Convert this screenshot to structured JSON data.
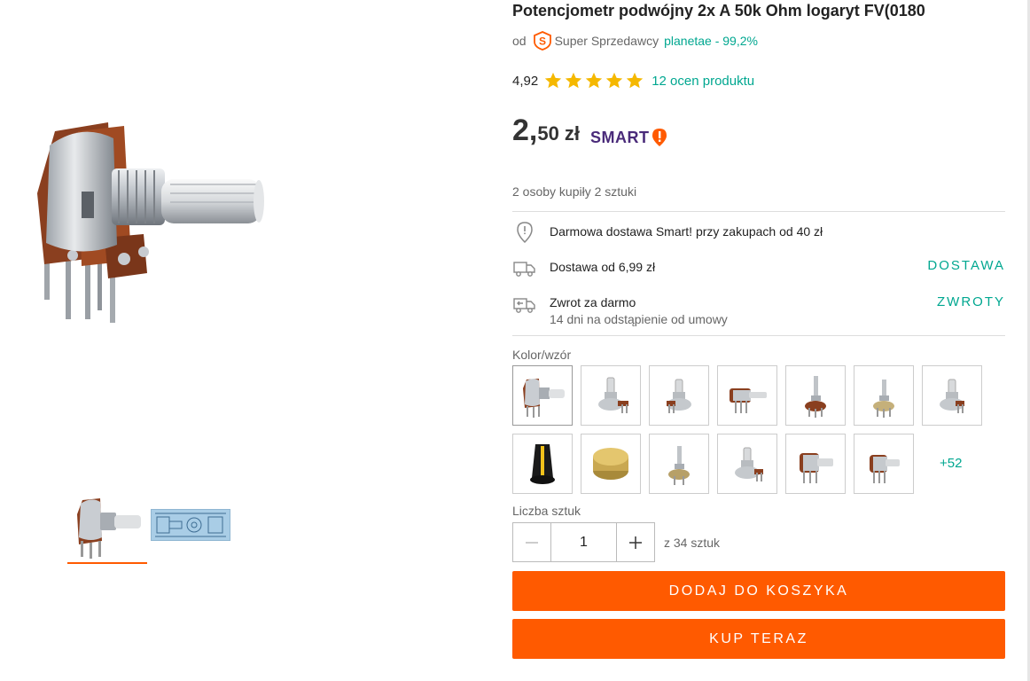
{
  "product": {
    "title": "Potencjometr podwójny 2x A 50k Ohm logaryt FV(0180",
    "seller_prefix": "od",
    "seller_badge": "Super Sprzedawcy",
    "seller_name": "planetae - 99,2%",
    "rating_score": "4,92",
    "rating_stars": 5,
    "rating_count": "12 ocen produktu",
    "price_main": "2,",
    "price_cents": "50",
    "price_currency": "zł",
    "smart_label": "SMART",
    "bought_text": "2 osoby kupiły 2 sztuki"
  },
  "delivery": {
    "free_text": "Darmowa dostawa Smart! przy zakupach od 40 zł",
    "cost_text": "Dostawa od 6,99 zł",
    "cost_link": "DOSTAWA",
    "return_text": "Zwrot za darmo",
    "return_sub": "14 dni na odstąpienie od umowy",
    "return_link": "ZWROTY"
  },
  "variants": {
    "label": "Kolor/wzór",
    "more_label": "+52",
    "selected_index": 0
  },
  "quantity": {
    "label": "Liczba sztuk",
    "value": "1",
    "of_text": "z 34 sztuk"
  },
  "actions": {
    "add_to_cart": "DODAJ DO KOSZYKA",
    "buy_now": "KUP TERAZ"
  },
  "colors": {
    "accent_orange": "#ff5a00",
    "link_teal": "#00a790",
    "star_yellow": "#f5b800",
    "smart_purple": "#4a2b7a"
  }
}
